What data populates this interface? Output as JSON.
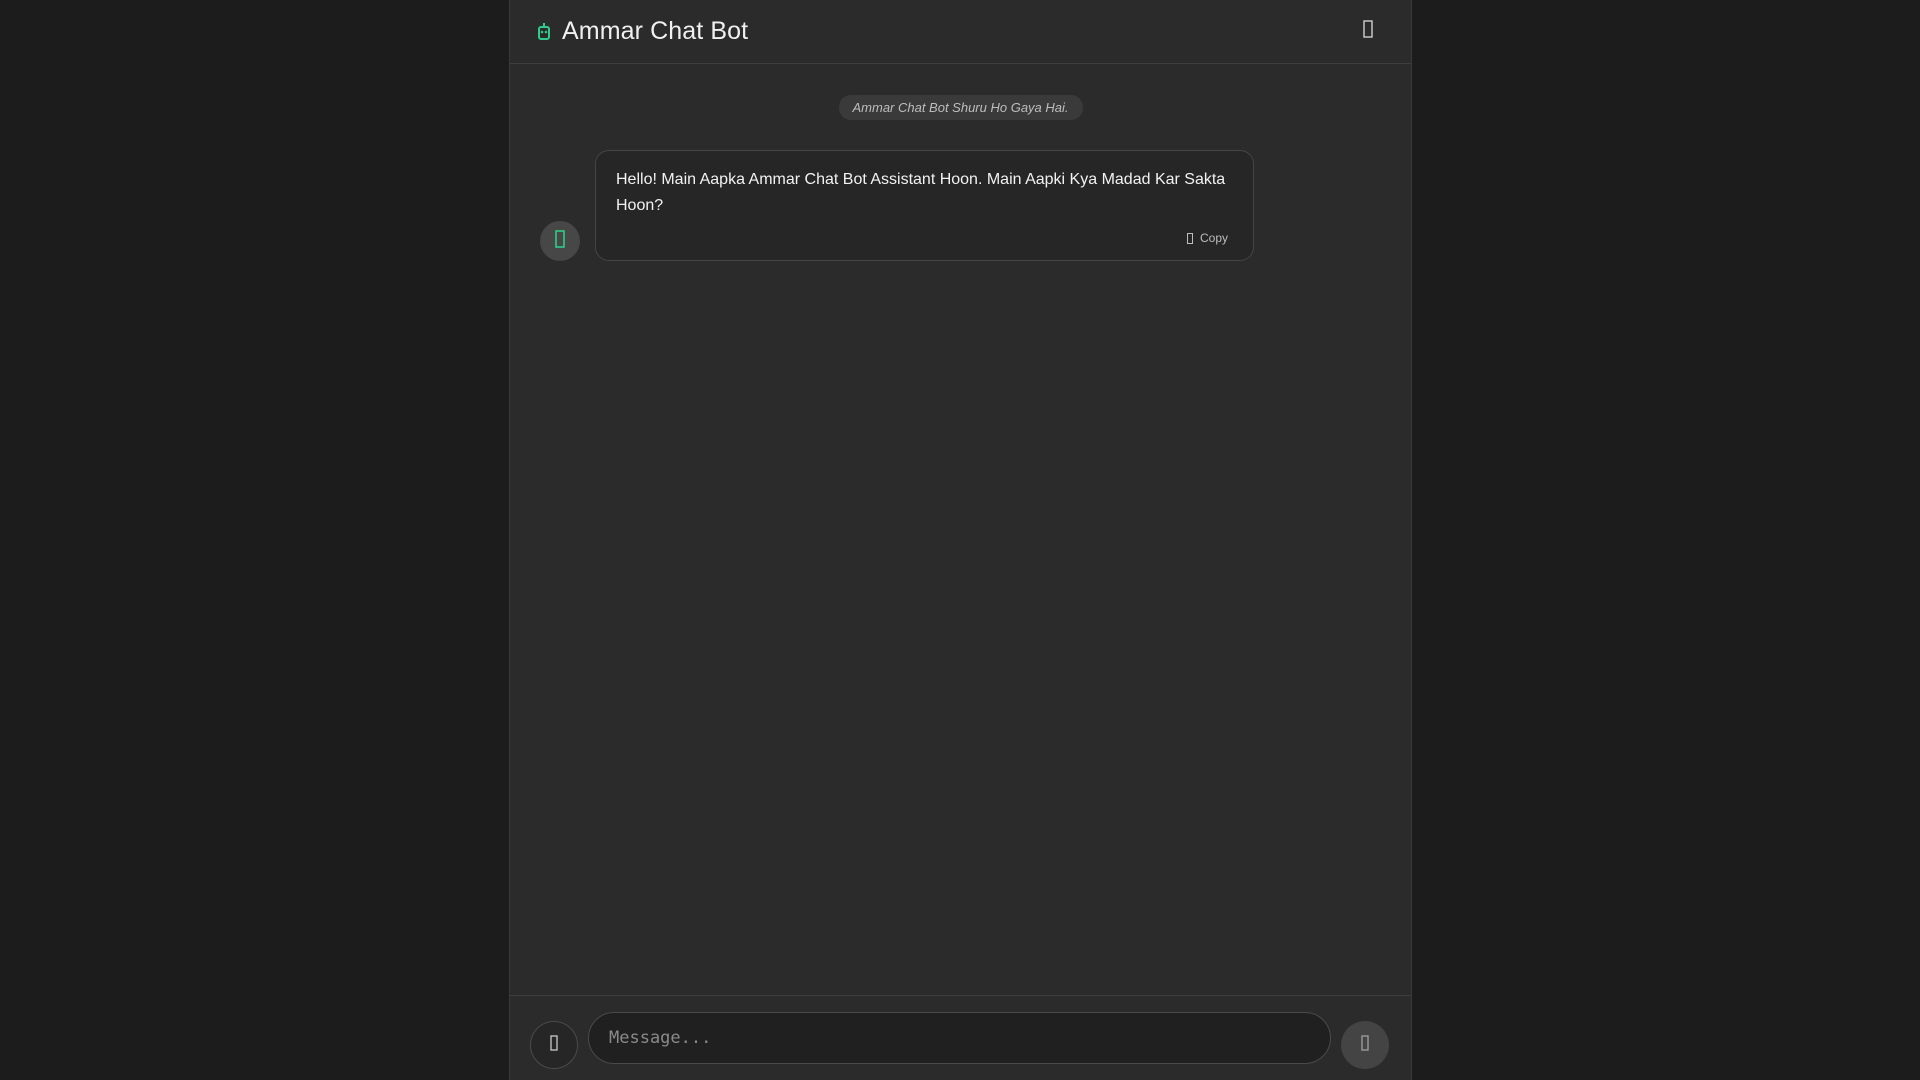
{
  "header": {
    "title": "Ammar Chat Bot",
    "brand_icon": "robot-icon",
    "menu_icon": "menu-icon"
  },
  "chat": {
    "system_notice": "Ammar Chat Bot Shuru Ho Gaya Hai.",
    "messages": [
      {
        "sender": "bot",
        "avatar_icon": "robot-icon",
        "text": "Hello! Main Aapka Ammar Chat Bot Assistant Hoon. Main Aapki Kya Madad Kar Sakta Hoon?",
        "copy_label": "Copy"
      }
    ]
  },
  "composer": {
    "placeholder": "Message...",
    "attach_icon": "attach-icon",
    "send_icon": "send-icon"
  },
  "colors": {
    "accent": "#2ecc8a",
    "background": "#1c1c1c",
    "panel": "#2b2b2b"
  }
}
